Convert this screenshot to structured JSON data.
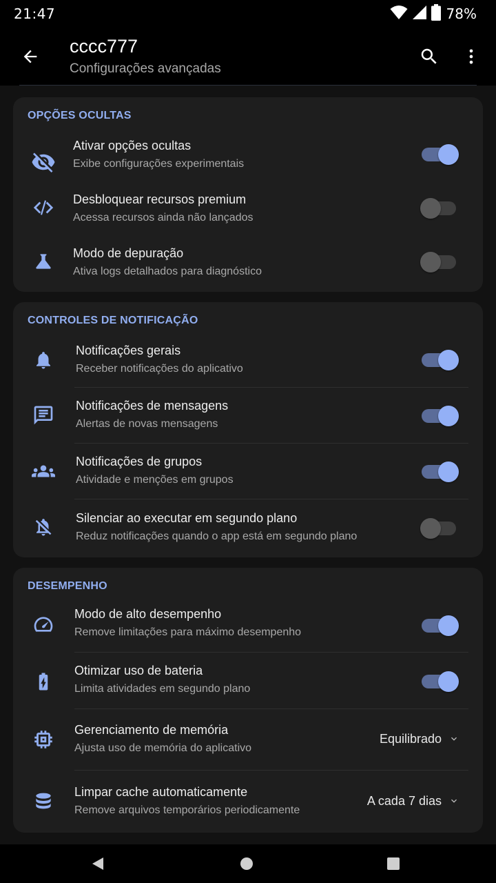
{
  "status": {
    "time": "21:47",
    "battery": "78%"
  },
  "appbar": {
    "title": "cccc777",
    "subtitle": "Configurações avançadas"
  },
  "sections": [
    {
      "title": "OPÇÕES OCULTAS",
      "items": [
        {
          "icon": "eye-off-icon",
          "title": "Ativar opções ocultas",
          "subtitle": "Exibe configurações experimentais",
          "type": "toggle",
          "on": true
        },
        {
          "icon": "code-icon",
          "title": "Desbloquear recursos premium",
          "subtitle": "Acessa recursos ainda não lançados",
          "type": "toggle",
          "on": false
        },
        {
          "icon": "flask-icon",
          "title": "Modo de depuração",
          "subtitle": "Ativa logs detalhados para diagnóstico",
          "type": "toggle",
          "on": false
        }
      ]
    },
    {
      "title": "CONTROLES DE NOTIFICAÇÃO",
      "items": [
        {
          "icon": "bell-icon",
          "title": "Notificações gerais",
          "subtitle": "Receber notificações do aplicativo",
          "type": "toggle",
          "on": true
        },
        {
          "icon": "message-icon",
          "title": "Notificações de mensagens",
          "subtitle": "Alertas de novas mensagens",
          "type": "toggle",
          "on": true
        },
        {
          "icon": "group-icon",
          "title": "Notificações de grupos",
          "subtitle": "Atividade e menções em grupos",
          "type": "toggle",
          "on": true
        },
        {
          "icon": "bell-off-icon",
          "title": "Silenciar ao executar em segundo plano",
          "subtitle": "Reduz notificações quando o app está em segundo plano",
          "type": "toggle",
          "on": false
        }
      ]
    },
    {
      "title": "DESEMPENHO",
      "items": [
        {
          "icon": "speedometer-icon",
          "title": "Modo de alto desempenho",
          "subtitle": "Remove limitações para máximo desempenho",
          "type": "toggle",
          "on": true
        },
        {
          "icon": "battery-icon",
          "title": "Otimizar uso de bateria",
          "subtitle": "Limita atividades em segundo plano",
          "type": "toggle",
          "on": true
        },
        {
          "icon": "chip-icon",
          "title": "Gerenciamento de memória",
          "subtitle": "Ajusta uso de memória do aplicativo",
          "type": "dropdown",
          "value": "Equilibrado"
        },
        {
          "icon": "database-icon",
          "title": "Limpar cache automaticamente",
          "subtitle": "Remove arquivos temporários periodicamente",
          "type": "dropdown",
          "value": "A cada 7 dias"
        }
      ]
    }
  ],
  "colors": {
    "accent": "#91aef0",
    "toggle_on_thumb": "#93b0f6",
    "toggle_on_track": "#5b6c99",
    "card": "#1e1e1e",
    "background": "#121212"
  }
}
